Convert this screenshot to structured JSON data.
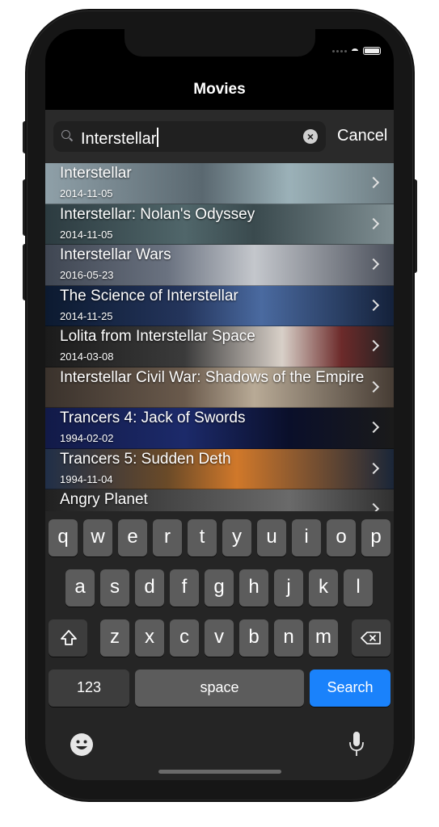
{
  "nav": {
    "title": "Movies"
  },
  "search": {
    "query": "Interstellar",
    "cancel_label": "Cancel"
  },
  "results": [
    {
      "title": "Interstellar",
      "date": "2014-11-05"
    },
    {
      "title": "Interstellar: Nolan's Odyssey",
      "date": "2014-11-05"
    },
    {
      "title": "Interstellar Wars",
      "date": "2016-05-23"
    },
    {
      "title": "The Science of Interstellar",
      "date": "2014-11-25"
    },
    {
      "title": "Lolita from Interstellar Space",
      "date": "2014-03-08"
    },
    {
      "title": "Interstellar Civil War: Shadows of the Empire",
      "date": ""
    },
    {
      "title": "Trancers 4: Jack of Swords",
      "date": "1994-02-02"
    },
    {
      "title": "Trancers 5: Sudden Deth",
      "date": "1994-11-04"
    },
    {
      "title": "Angry Planet",
      "date": ""
    }
  ],
  "keyboard": {
    "row1": [
      "q",
      "w",
      "e",
      "r",
      "t",
      "y",
      "u",
      "i",
      "o",
      "p"
    ],
    "row2": [
      "a",
      "s",
      "d",
      "f",
      "g",
      "h",
      "j",
      "k",
      "l"
    ],
    "row3": [
      "z",
      "x",
      "c",
      "v",
      "b",
      "n",
      "m"
    ],
    "numbers_label": "123",
    "space_label": "space",
    "search_label": "Search"
  },
  "colors": {
    "accent": "#1a82fb",
    "key": "#5c5c5c",
    "keyboard_bg": "#252525"
  }
}
